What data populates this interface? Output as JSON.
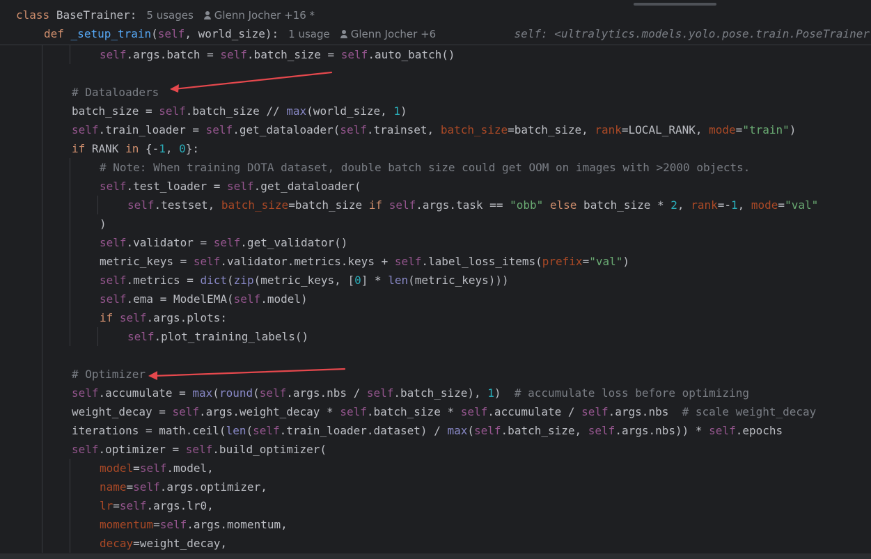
{
  "sticky_header": {
    "class_keyword": "class",
    "class_name": "BaseTrainer:",
    "class_usages": "5 usages",
    "class_author": "Glenn Jocher +16 *",
    "def_keyword": "def",
    "def_name": "_setup_train",
    "def_open": "(",
    "def_self": "self",
    "def_args": ", world_size):",
    "def_usages": "1 usage",
    "def_author": "Glenn Jocher +6",
    "self_hint": "self: <ultralytics.models.yolo.pose.train.PoseTrainer"
  },
  "code_lines": [
    {
      "indent": 3,
      "tokens": [
        [
          "self",
          "self"
        ],
        [
          "p",
          ".args.batch = "
        ],
        [
          "self",
          "self"
        ],
        [
          "p",
          ".batch_size = "
        ],
        [
          "self",
          "self"
        ],
        [
          "p",
          ".auto_batch()"
        ]
      ]
    },
    {
      "indent": 0,
      "tokens": []
    },
    {
      "indent": 2,
      "tokens": [
        [
          "cmt",
          "# Dataloaders"
        ]
      ]
    },
    {
      "indent": 2,
      "tokens": [
        [
          "p",
          "batch_size = "
        ],
        [
          "self",
          "self"
        ],
        [
          "p",
          ".batch_size // "
        ],
        [
          "bi",
          "max"
        ],
        [
          "p",
          "(world_size, "
        ],
        [
          "num",
          "1"
        ],
        [
          "p",
          ")"
        ]
      ]
    },
    {
      "indent": 2,
      "tokens": [
        [
          "self",
          "self"
        ],
        [
          "p",
          ".train_loader = "
        ],
        [
          "self",
          "self"
        ],
        [
          "p",
          ".get_dataloader("
        ],
        [
          "self",
          "self"
        ],
        [
          "p",
          ".trainset, "
        ],
        [
          "param",
          "batch_size"
        ],
        [
          "p",
          "=batch_size, "
        ],
        [
          "param",
          "rank"
        ],
        [
          "p",
          "=LOCAL_RANK, "
        ],
        [
          "param",
          "mode"
        ],
        [
          "p",
          "="
        ],
        [
          "str",
          "\"train\""
        ],
        [
          "p",
          ")"
        ]
      ]
    },
    {
      "indent": 2,
      "tokens": [
        [
          "kw",
          "if"
        ],
        [
          "p",
          " RANK "
        ],
        [
          "kw",
          "in"
        ],
        [
          "p",
          " {-"
        ],
        [
          "num",
          "1"
        ],
        [
          "p",
          ", "
        ],
        [
          "num",
          "0"
        ],
        [
          "p",
          "}:"
        ]
      ]
    },
    {
      "indent": 3,
      "tokens": [
        [
          "cmt",
          "# Note: When training DOTA dataset, double batch size could get OOM on images with >2000 objects."
        ]
      ]
    },
    {
      "indent": 3,
      "tokens": [
        [
          "self",
          "self"
        ],
        [
          "p",
          ".test_loader = "
        ],
        [
          "self",
          "self"
        ],
        [
          "p",
          ".get_dataloader("
        ]
      ]
    },
    {
      "indent": 4,
      "tokens": [
        [
          "self",
          "self"
        ],
        [
          "p",
          ".testset, "
        ],
        [
          "param",
          "batch_size"
        ],
        [
          "p",
          "=batch_size "
        ],
        [
          "kw",
          "if"
        ],
        [
          "p",
          " "
        ],
        [
          "self",
          "self"
        ],
        [
          "p",
          ".args.task == "
        ],
        [
          "str",
          "\"obb\""
        ],
        [
          "p",
          " "
        ],
        [
          "kw",
          "else"
        ],
        [
          "p",
          " batch_size * "
        ],
        [
          "num",
          "2"
        ],
        [
          "p",
          ", "
        ],
        [
          "param",
          "rank"
        ],
        [
          "p",
          "=-"
        ],
        [
          "num",
          "1"
        ],
        [
          "p",
          ", "
        ],
        [
          "param",
          "mode"
        ],
        [
          "p",
          "="
        ],
        [
          "str",
          "\"val\""
        ]
      ]
    },
    {
      "indent": 3,
      "tokens": [
        [
          "p",
          ")"
        ]
      ]
    },
    {
      "indent": 3,
      "tokens": [
        [
          "self",
          "self"
        ],
        [
          "p",
          ".validator = "
        ],
        [
          "self",
          "self"
        ],
        [
          "p",
          ".get_validator()"
        ]
      ]
    },
    {
      "indent": 3,
      "tokens": [
        [
          "p",
          "metric_keys = "
        ],
        [
          "self",
          "self"
        ],
        [
          "p",
          ".validator.metrics.keys + "
        ],
        [
          "self",
          "self"
        ],
        [
          "p",
          ".label_loss_items("
        ],
        [
          "param",
          "prefix"
        ],
        [
          "p",
          "="
        ],
        [
          "str",
          "\"val\""
        ],
        [
          "p",
          ")"
        ]
      ]
    },
    {
      "indent": 3,
      "tokens": [
        [
          "self",
          "self"
        ],
        [
          "p",
          ".metrics = "
        ],
        [
          "bi",
          "dict"
        ],
        [
          "p",
          "("
        ],
        [
          "bi",
          "zip"
        ],
        [
          "p",
          "(metric_keys, ["
        ],
        [
          "num",
          "0"
        ],
        [
          "p",
          "] * "
        ],
        [
          "bi",
          "len"
        ],
        [
          "p",
          "(metric_keys)))"
        ]
      ]
    },
    {
      "indent": 3,
      "tokens": [
        [
          "self",
          "self"
        ],
        [
          "p",
          ".ema = ModelEMA("
        ],
        [
          "self",
          "self"
        ],
        [
          "p",
          ".model)"
        ]
      ]
    },
    {
      "indent": 3,
      "tokens": [
        [
          "kw",
          "if"
        ],
        [
          "p",
          " "
        ],
        [
          "self",
          "self"
        ],
        [
          "p",
          ".args.plots:"
        ]
      ]
    },
    {
      "indent": 4,
      "tokens": [
        [
          "self",
          "self"
        ],
        [
          "p",
          ".plot_training_labels()"
        ]
      ]
    },
    {
      "indent": 0,
      "tokens": []
    },
    {
      "indent": 2,
      "tokens": [
        [
          "cmt",
          "# Optimizer"
        ]
      ]
    },
    {
      "indent": 2,
      "tokens": [
        [
          "self",
          "self"
        ],
        [
          "p",
          ".accumulate = "
        ],
        [
          "bi",
          "max"
        ],
        [
          "p",
          "("
        ],
        [
          "bi",
          "round"
        ],
        [
          "p",
          "("
        ],
        [
          "self",
          "self"
        ],
        [
          "p",
          ".args.nbs / "
        ],
        [
          "self",
          "self"
        ],
        [
          "p",
          ".batch_size), "
        ],
        [
          "num",
          "1"
        ],
        [
          "p",
          ")  "
        ],
        [
          "cmt",
          "# accumulate loss before optimizing"
        ]
      ]
    },
    {
      "indent": 2,
      "tokens": [
        [
          "p",
          "weight_decay = "
        ],
        [
          "self",
          "self"
        ],
        [
          "p",
          ".args.weight_decay * "
        ],
        [
          "self",
          "self"
        ],
        [
          "p",
          ".batch_size * "
        ],
        [
          "self",
          "self"
        ],
        [
          "p",
          ".accumulate / "
        ],
        [
          "self",
          "self"
        ],
        [
          "p",
          ".args.nbs  "
        ],
        [
          "cmt",
          "# scale weight_decay"
        ]
      ]
    },
    {
      "indent": 2,
      "tokens": [
        [
          "p",
          "iterations = math.ceil("
        ],
        [
          "bi",
          "len"
        ],
        [
          "p",
          "("
        ],
        [
          "self",
          "self"
        ],
        [
          "p",
          ".train_loader.dataset) / "
        ],
        [
          "bi",
          "max"
        ],
        [
          "p",
          "("
        ],
        [
          "self",
          "self"
        ],
        [
          "p",
          ".batch_size, "
        ],
        [
          "self",
          "self"
        ],
        [
          "p",
          ".args.nbs)) * "
        ],
        [
          "self",
          "self"
        ],
        [
          "p",
          ".epochs"
        ]
      ]
    },
    {
      "indent": 2,
      "tokens": [
        [
          "self",
          "self"
        ],
        [
          "p",
          ".optimizer = "
        ],
        [
          "self",
          "self"
        ],
        [
          "p",
          ".build_optimizer("
        ]
      ]
    },
    {
      "indent": 3,
      "tokens": [
        [
          "param",
          "model"
        ],
        [
          "p",
          "="
        ],
        [
          "self",
          "self"
        ],
        [
          "p",
          ".model,"
        ]
      ]
    },
    {
      "indent": 3,
      "tokens": [
        [
          "param",
          "name"
        ],
        [
          "p",
          "="
        ],
        [
          "self",
          "self"
        ],
        [
          "p",
          ".args.optimizer,"
        ]
      ]
    },
    {
      "indent": 3,
      "tokens": [
        [
          "param",
          "lr"
        ],
        [
          "p",
          "="
        ],
        [
          "self",
          "self"
        ],
        [
          "p",
          ".args.lr0,"
        ]
      ]
    },
    {
      "indent": 3,
      "tokens": [
        [
          "param",
          "momentum"
        ],
        [
          "p",
          "="
        ],
        [
          "self",
          "self"
        ],
        [
          "p",
          ".args.momentum,"
        ]
      ]
    },
    {
      "indent": 3,
      "tokens": [
        [
          "param",
          "decay"
        ],
        [
          "p",
          "=weight_decay,"
        ]
      ]
    }
  ],
  "colors": {
    "background": "#1e1f22",
    "default_text": "#bcbec4",
    "keyword": "#cf8e6d",
    "self": "#94558d",
    "function_def": "#56a8f5",
    "builtin": "#8888c6",
    "number": "#2aacb8",
    "string": "#6aab73",
    "comment": "#7a7e85",
    "param": "#aa4926",
    "annotation_arrow": "#e5484d"
  }
}
